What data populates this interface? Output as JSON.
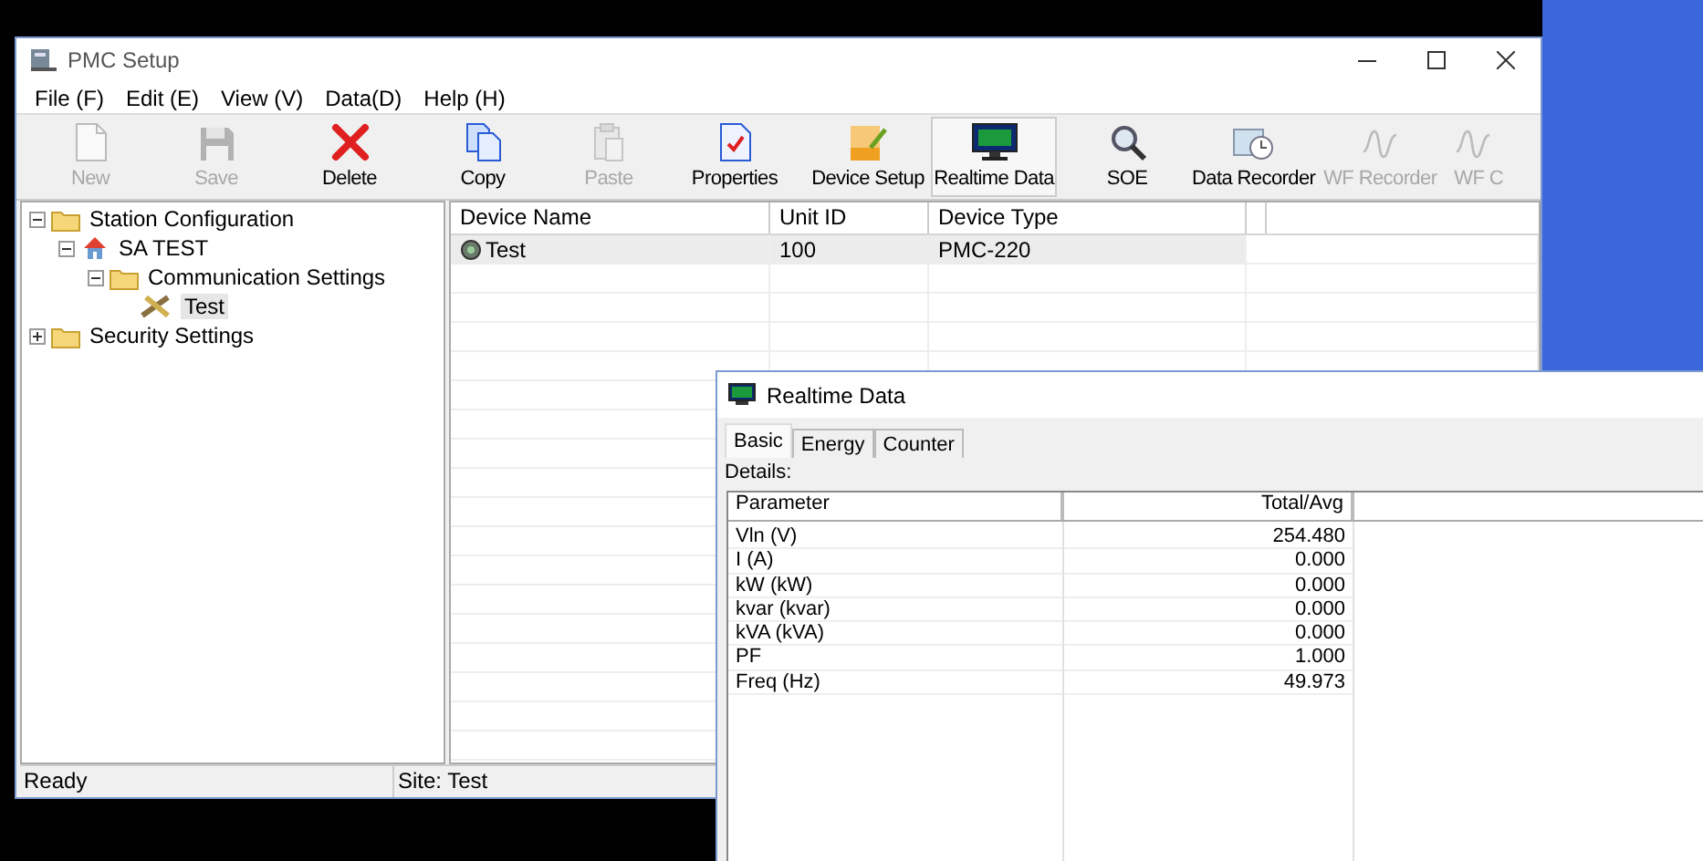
{
  "window": {
    "title": "PMC Setup"
  },
  "menu": [
    "File (F)",
    "Edit (E)",
    "View (V)",
    "Data(D)",
    "Help (H)"
  ],
  "toolbar": [
    [
      {
        "label": "New",
        "disabled": true,
        "pressed": false
      },
      {
        "label": "Save",
        "disabled": true,
        "pressed": false
      }
    ],
    [
      {
        "label": "Delete",
        "disabled": false,
        "pressed": false
      }
    ],
    [
      {
        "label": "Copy",
        "disabled": false,
        "pressed": false
      },
      {
        "label": "Paste",
        "disabled": true,
        "pressed": false
      },
      {
        "label": "Properties",
        "disabled": false,
        "pressed": false
      }
    ],
    [
      {
        "label": "Device Setup",
        "disabled": false,
        "pressed": false
      },
      {
        "label": "Realtime Data",
        "disabled": false,
        "pressed": true
      }
    ],
    [
      {
        "label": "SOE",
        "disabled": false,
        "pressed": false
      },
      {
        "label": "Data Recorder",
        "disabled": false,
        "pressed": false
      },
      {
        "label": "WF Recorder",
        "disabled": true,
        "pressed": false
      },
      {
        "label": "WF C",
        "disabled": true,
        "pressed": false
      }
    ]
  ],
  "tree": [
    {
      "label": "Station Configuration",
      "kind": "folder",
      "expanded": true,
      "selected": false,
      "children": [
        {
          "label": "SA TEST",
          "kind": "station",
          "expanded": true,
          "selected": false,
          "children": [
            {
              "label": "Communication Settings",
              "kind": "folder",
              "expanded": true,
              "selected": false,
              "children": [
                {
                  "label": "Test",
                  "kind": "device",
                  "selected": true
                }
              ]
            }
          ]
        }
      ]
    },
    {
      "label": "Security Settings",
      "kind": "folder",
      "expanded": false,
      "selected": false
    }
  ],
  "device_table": {
    "columns": [
      "Device Name",
      "Unit ID",
      "Device Type"
    ],
    "rows": [
      {
        "cells": [
          "Test",
          "100",
          "PMC-220"
        ],
        "selected": true
      }
    ]
  },
  "status_bar": [
    "Ready",
    "Site: Test"
  ],
  "realtime_window": {
    "title": "Realtime Data",
    "tabs": [
      {
        "label": "Basic",
        "selected": true
      },
      {
        "label": "Energy",
        "selected": false
      },
      {
        "label": "Counter",
        "selected": false
      }
    ],
    "details_label": "Details:",
    "table": {
      "columns": [
        "Parameter",
        "Total/Avg"
      ],
      "rows": [
        [
          "Vln (V)",
          "254.480"
        ],
        [
          "I (A)",
          "0.000"
        ],
        [
          "kW (kW)",
          "0.000"
        ],
        [
          "kvar (kvar)",
          "0.000"
        ],
        [
          "kVA (kVA)",
          "0.000"
        ],
        [
          "PF",
          "1.000"
        ],
        [
          "Freq (Hz)",
          "49.973"
        ]
      ]
    }
  }
}
